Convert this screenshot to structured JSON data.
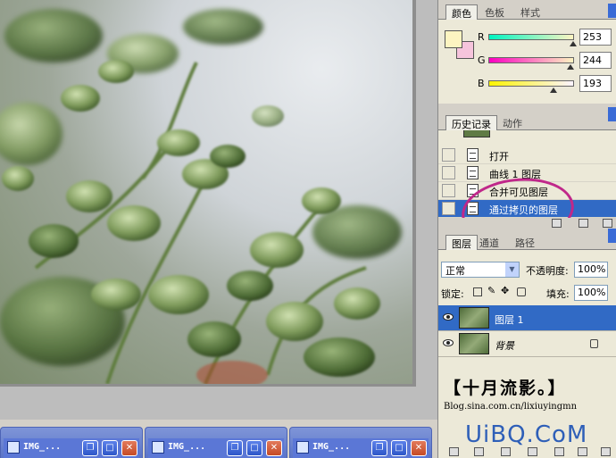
{
  "documents": [
    {
      "title": "IMG_..."
    },
    {
      "title": "IMG_..."
    },
    {
      "title": "IMG_..."
    }
  ],
  "color_panel": {
    "tabs": [
      "颜色",
      "色板",
      "样式"
    ],
    "active_tab": 0,
    "foreground_color": "#fdf4c1",
    "background_color": "#f6c4dc",
    "channels": [
      {
        "label": "R",
        "value": "253",
        "fill": 0.99
      },
      {
        "label": "G",
        "value": "244",
        "fill": 0.96
      },
      {
        "label": "B",
        "value": "193",
        "fill": 0.76
      }
    ]
  },
  "history_panel": {
    "tabs": [
      "历史记录",
      "动作"
    ],
    "active_tab": 0,
    "items": [
      {
        "label": "打开",
        "selected": false
      },
      {
        "label": "曲线 1 图层",
        "selected": false
      },
      {
        "label": "合并可见图层",
        "selected": false
      },
      {
        "label": "通过拷贝的图层",
        "selected": true
      }
    ],
    "annotation_color": "#c0288a"
  },
  "layers_panel": {
    "tabs": [
      "图层",
      "通道",
      "路径"
    ],
    "active_tab": 0,
    "blend_mode": "正常",
    "opacity_label": "不透明度:",
    "opacity_value": "100%",
    "lock_label": "锁定:",
    "fill_label": "填充:",
    "fill_value": "100%",
    "layers": [
      {
        "name": "图层 1",
        "selected": true,
        "locked": false
      },
      {
        "name": "背景",
        "selected": false,
        "locked": true
      }
    ]
  },
  "watermark": {
    "title": "【十月流影。】",
    "url": "Blog.sina.com.cn/lixiuyingmn",
    "brand": "UiBQ.CoM"
  }
}
